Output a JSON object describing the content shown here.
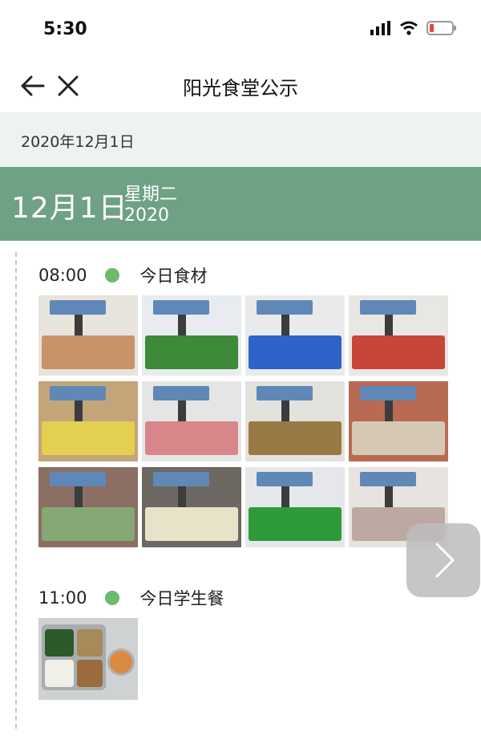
{
  "status_bar": {
    "time": "5:30",
    "icons": [
      "signal-icon",
      "wifi-icon",
      "battery-low-icon"
    ],
    "battery_color": "#e5473f"
  },
  "nav": {
    "title": "阳光食堂公示",
    "icons": [
      "back-arrow-icon",
      "close-icon"
    ]
  },
  "date_strip": {
    "text": "2020年12月1日"
  },
  "day_header": {
    "big_date": "12月1日",
    "weekday": "星期二",
    "year": "2020",
    "color": "#6fa184"
  },
  "sections": [
    {
      "time": "08:00",
      "label": "今日食材",
      "photo_count": 12
    },
    {
      "time": "11:00",
      "label": "今日学生餐",
      "photo_count": 1
    }
  ],
  "ingredient_photos": [
    {
      "name": "sweet-potatoes",
      "crate": "#c7936b",
      "bg": "#e7e3dd"
    },
    {
      "name": "green-vegetables",
      "crate": "#3c8a3a",
      "bg": "#e9ecef"
    },
    {
      "name": "tofu-bags",
      "crate": "#2f63c7",
      "bg": "#e8eaec"
    },
    {
      "name": "tomatoes",
      "crate": "#c6463a",
      "bg": "#e8e7e4"
    },
    {
      "name": "yellow-packs",
      "crate": "#e3cf52",
      "bg": "#c4a57a"
    },
    {
      "name": "meat-slices",
      "crate": "#d8868a",
      "bg": "#e5e5e5"
    },
    {
      "name": "kiwi-box",
      "crate": "#9a7a44",
      "bg": "#e3e2dd"
    },
    {
      "name": "bagged-items",
      "crate": "#d6c9b4",
      "bg": "#b86a52"
    },
    {
      "name": "cabbage",
      "crate": "#86a874",
      "bg": "#8c6f63"
    },
    {
      "name": "garlic",
      "crate": "#e8e3c8",
      "bg": "#6d6862"
    },
    {
      "name": "green-peppers",
      "crate": "#2f9a3a",
      "bg": "#e6e7ea"
    },
    {
      "name": "frozen-meat",
      "crate": "#bda8a2",
      "bg": "#e7e4df"
    }
  ],
  "meal_photo": {
    "name": "student-meal-tray"
  },
  "next_button": {
    "icon": "chevron-right-icon"
  }
}
